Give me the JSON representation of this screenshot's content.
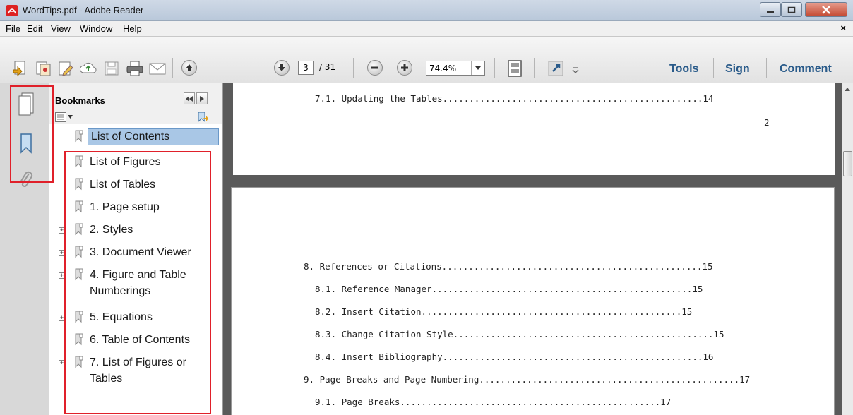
{
  "window": {
    "title": "WordTips.pdf - Adobe Reader"
  },
  "menu": {
    "items": [
      "File",
      "Edit",
      "View",
      "Window",
      "Help"
    ],
    "close_glyph": "×"
  },
  "toolbar": {
    "page_current": "3",
    "page_total": "/ 31",
    "zoom": "74.4%",
    "tools_label": "Tools",
    "sign_label": "Sign",
    "comment_label": "Comment"
  },
  "bookmarks": {
    "title": "Bookmarks",
    "items": [
      {
        "label": "List of Contents",
        "expandable": false,
        "selected": true
      },
      {
        "label": "List of Figures",
        "expandable": false
      },
      {
        "label": "List of Tables",
        "expandable": false
      },
      {
        "label": "1. Page setup",
        "expandable": false
      },
      {
        "label": "2. Styles",
        "expandable": true
      },
      {
        "label": "3. Document Viewer",
        "expandable": true
      },
      {
        "label": "4. Figure and Table",
        "label2": "Numberings",
        "expandable": true
      },
      {
        "label": "5. Equations",
        "expandable": true
      },
      {
        "label": "6. Table of Contents",
        "expandable": false
      },
      {
        "label": "7. List of Figures or",
        "label2": "Tables",
        "expandable": true
      }
    ]
  },
  "document": {
    "page1": {
      "toc_line": "7.1. Updating the Tables.................................................14",
      "page_number": "2"
    },
    "page2": {
      "toc_lines": [
        "8. References or Citations.................................................15",
        "8.1. Reference Manager.................................................15",
        "8.2. Insert Citation.................................................15",
        "8.3. Change Citation Style.................................................15",
        "8.4. Insert Bibliography.................................................16",
        "9. Page Breaks and Page Numbering.................................................17",
        "9.1. Page Breaks.................................................17"
      ]
    }
  },
  "colors": {
    "highlight_box": "#e0202a",
    "link_blue": "#2a5b8a",
    "selected_row": "#a9c7e6"
  }
}
